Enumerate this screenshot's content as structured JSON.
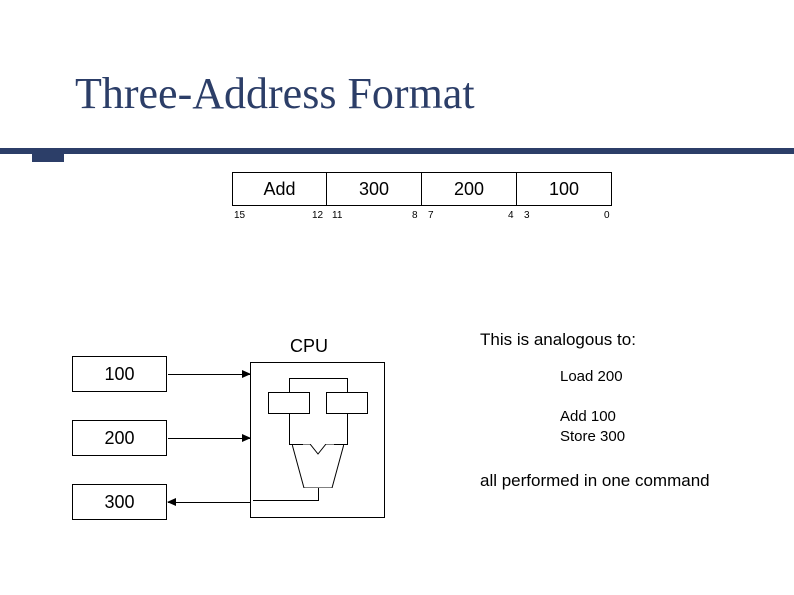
{
  "title": "Three-Address Format",
  "instruction": {
    "op": "Add",
    "addr1": "300",
    "addr2": "200",
    "addr3": "100"
  },
  "bits": {
    "b15": "15",
    "b12": "12",
    "b11": "11",
    "b8": "8",
    "b7": "7",
    "b4": "4",
    "b3": "3",
    "b0": "0"
  },
  "memory": {
    "cell100": "100",
    "cell200": "200",
    "cell300": "300"
  },
  "cpu": {
    "label": "CPU"
  },
  "explain": {
    "intro": "This is analogous to:",
    "load": "Load 200",
    "add": "Add 100",
    "store": "Store 300",
    "footer": "all performed in one command"
  }
}
